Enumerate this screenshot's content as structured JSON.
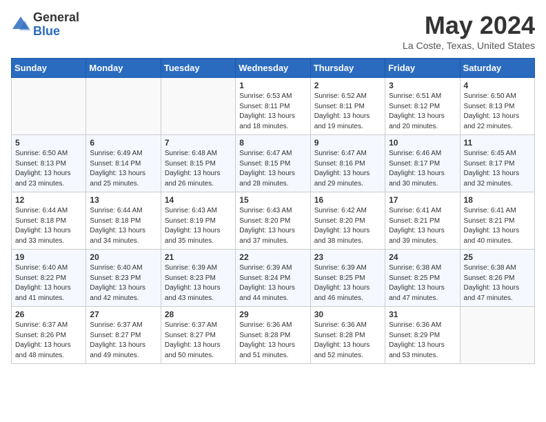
{
  "header": {
    "logo_general": "General",
    "logo_blue": "Blue",
    "title": "May 2024",
    "subtitle": "La Coste, Texas, United States"
  },
  "columns": [
    "Sunday",
    "Monday",
    "Tuesday",
    "Wednesday",
    "Thursday",
    "Friday",
    "Saturday"
  ],
  "weeks": [
    [
      {
        "day": "",
        "content": ""
      },
      {
        "day": "",
        "content": ""
      },
      {
        "day": "",
        "content": ""
      },
      {
        "day": "1",
        "content": "Sunrise: 6:53 AM\nSunset: 8:11 PM\nDaylight: 13 hours and 18 minutes."
      },
      {
        "day": "2",
        "content": "Sunrise: 6:52 AM\nSunset: 8:11 PM\nDaylight: 13 hours and 19 minutes."
      },
      {
        "day": "3",
        "content": "Sunrise: 6:51 AM\nSunset: 8:12 PM\nDaylight: 13 hours and 20 minutes."
      },
      {
        "day": "4",
        "content": "Sunrise: 6:50 AM\nSunset: 8:13 PM\nDaylight: 13 hours and 22 minutes."
      }
    ],
    [
      {
        "day": "5",
        "content": "Sunrise: 6:50 AM\nSunset: 8:13 PM\nDaylight: 13 hours and 23 minutes."
      },
      {
        "day": "6",
        "content": "Sunrise: 6:49 AM\nSunset: 8:14 PM\nDaylight: 13 hours and 25 minutes."
      },
      {
        "day": "7",
        "content": "Sunrise: 6:48 AM\nSunset: 8:15 PM\nDaylight: 13 hours and 26 minutes."
      },
      {
        "day": "8",
        "content": "Sunrise: 6:47 AM\nSunset: 8:15 PM\nDaylight: 13 hours and 28 minutes."
      },
      {
        "day": "9",
        "content": "Sunrise: 6:47 AM\nSunset: 8:16 PM\nDaylight: 13 hours and 29 minutes."
      },
      {
        "day": "10",
        "content": "Sunrise: 6:46 AM\nSunset: 8:17 PM\nDaylight: 13 hours and 30 minutes."
      },
      {
        "day": "11",
        "content": "Sunrise: 6:45 AM\nSunset: 8:17 PM\nDaylight: 13 hours and 32 minutes."
      }
    ],
    [
      {
        "day": "12",
        "content": "Sunrise: 6:44 AM\nSunset: 8:18 PM\nDaylight: 13 hours and 33 minutes."
      },
      {
        "day": "13",
        "content": "Sunrise: 6:44 AM\nSunset: 8:18 PM\nDaylight: 13 hours and 34 minutes."
      },
      {
        "day": "14",
        "content": "Sunrise: 6:43 AM\nSunset: 8:19 PM\nDaylight: 13 hours and 35 minutes."
      },
      {
        "day": "15",
        "content": "Sunrise: 6:43 AM\nSunset: 8:20 PM\nDaylight: 13 hours and 37 minutes."
      },
      {
        "day": "16",
        "content": "Sunrise: 6:42 AM\nSunset: 8:20 PM\nDaylight: 13 hours and 38 minutes."
      },
      {
        "day": "17",
        "content": "Sunrise: 6:41 AM\nSunset: 8:21 PM\nDaylight: 13 hours and 39 minutes."
      },
      {
        "day": "18",
        "content": "Sunrise: 6:41 AM\nSunset: 8:21 PM\nDaylight: 13 hours and 40 minutes."
      }
    ],
    [
      {
        "day": "19",
        "content": "Sunrise: 6:40 AM\nSunset: 8:22 PM\nDaylight: 13 hours and 41 minutes."
      },
      {
        "day": "20",
        "content": "Sunrise: 6:40 AM\nSunset: 8:23 PM\nDaylight: 13 hours and 42 minutes."
      },
      {
        "day": "21",
        "content": "Sunrise: 6:39 AM\nSunset: 8:23 PM\nDaylight: 13 hours and 43 minutes."
      },
      {
        "day": "22",
        "content": "Sunrise: 6:39 AM\nSunset: 8:24 PM\nDaylight: 13 hours and 44 minutes."
      },
      {
        "day": "23",
        "content": "Sunrise: 6:39 AM\nSunset: 8:25 PM\nDaylight: 13 hours and 46 minutes."
      },
      {
        "day": "24",
        "content": "Sunrise: 6:38 AM\nSunset: 8:25 PM\nDaylight: 13 hours and 47 minutes."
      },
      {
        "day": "25",
        "content": "Sunrise: 6:38 AM\nSunset: 8:26 PM\nDaylight: 13 hours and 47 minutes."
      }
    ],
    [
      {
        "day": "26",
        "content": "Sunrise: 6:37 AM\nSunset: 8:26 PM\nDaylight: 13 hours and 48 minutes."
      },
      {
        "day": "27",
        "content": "Sunrise: 6:37 AM\nSunset: 8:27 PM\nDaylight: 13 hours and 49 minutes."
      },
      {
        "day": "28",
        "content": "Sunrise: 6:37 AM\nSunset: 8:27 PM\nDaylight: 13 hours and 50 minutes."
      },
      {
        "day": "29",
        "content": "Sunrise: 6:36 AM\nSunset: 8:28 PM\nDaylight: 13 hours and 51 minutes."
      },
      {
        "day": "30",
        "content": "Sunrise: 6:36 AM\nSunset: 8:28 PM\nDaylight: 13 hours and 52 minutes."
      },
      {
        "day": "31",
        "content": "Sunrise: 6:36 AM\nSunset: 8:29 PM\nDaylight: 13 hours and 53 minutes."
      },
      {
        "day": "",
        "content": ""
      }
    ]
  ]
}
